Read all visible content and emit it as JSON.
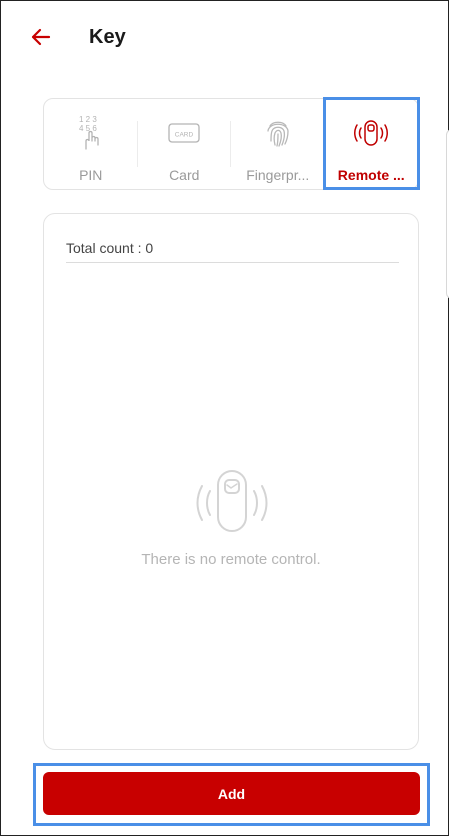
{
  "header": {
    "back_icon": "arrow-left-icon",
    "title": "Key"
  },
  "tabs": [
    {
      "label": "PIN",
      "icon": "pin-keypad-icon",
      "active": false
    },
    {
      "label": "Card",
      "icon": "card-icon",
      "icon_text": "CARD",
      "active": false
    },
    {
      "label": "Fingerpr...",
      "icon": "fingerprint-icon",
      "active": false
    },
    {
      "label": "Remote ...",
      "icon": "remote-control-icon",
      "active": true
    }
  ],
  "content": {
    "total_count": "Total count : 0",
    "empty_icon": "remote-control-icon",
    "empty_message": "There is no remote control."
  },
  "footer": {
    "add_label": "Add"
  },
  "colors": {
    "accent": "#c80000",
    "highlight": "#4a8fe7",
    "inactive_text": "#9a9a9a"
  }
}
